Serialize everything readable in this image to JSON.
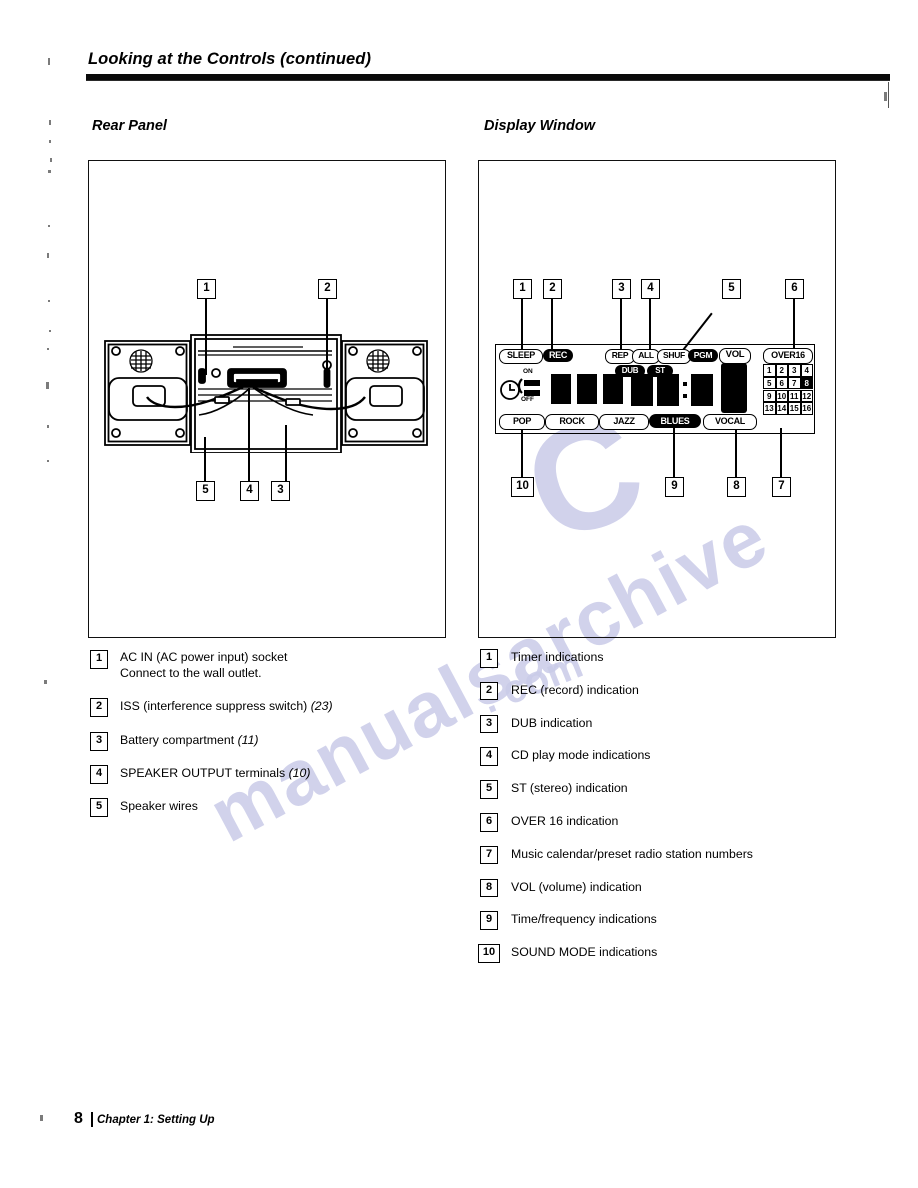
{
  "header": {
    "title": "Looking at the Controls (continued)"
  },
  "sections": {
    "rear": {
      "heading": "Rear Panel"
    },
    "display": {
      "heading": "Display Window"
    }
  },
  "rear_callouts": [
    {
      "num": "1"
    },
    {
      "num": "2"
    },
    {
      "num": "3"
    },
    {
      "num": "4"
    },
    {
      "num": "5"
    }
  ],
  "display_callouts": [
    {
      "num": "1"
    },
    {
      "num": "2"
    },
    {
      "num": "3"
    },
    {
      "num": "4"
    },
    {
      "num": "5"
    },
    {
      "num": "6"
    },
    {
      "num": "7"
    },
    {
      "num": "8"
    },
    {
      "num": "9"
    },
    {
      "num": "10"
    }
  ],
  "rear_legend": [
    {
      "num": "1",
      "line1": "AC IN (AC power input) socket",
      "line2": "Connect to the wall outlet.",
      "page": ""
    },
    {
      "num": "2",
      "line1": "ISS (interference suppress switch)",
      "line2": "",
      "page": "(23)"
    },
    {
      "num": "3",
      "line1": "Battery compartment",
      "line2": "",
      "page": "(11)"
    },
    {
      "num": "4",
      "line1": "SPEAKER OUTPUT terminals",
      "line2": "",
      "page": "(10)"
    },
    {
      "num": "5",
      "line1": "Speaker wires",
      "line2": "",
      "page": ""
    }
  ],
  "display_legend": [
    {
      "num": "1",
      "text": "Timer indications"
    },
    {
      "num": "2",
      "text": "REC (record) indication"
    },
    {
      "num": "3",
      "text": "DUB indication"
    },
    {
      "num": "4",
      "text": "CD play mode indications"
    },
    {
      "num": "5",
      "text": "ST (stereo) indication"
    },
    {
      "num": "6",
      "text": "OVER 16 indication"
    },
    {
      "num": "7",
      "text": "Music calendar/preset radio station numbers"
    },
    {
      "num": "8",
      "text": "VOL (volume) indication"
    },
    {
      "num": "9",
      "text": "Time/frequency indications"
    },
    {
      "num": "10",
      "text": "SOUND MODE indications"
    }
  ],
  "lcd": {
    "sleep": "SLEEP",
    "rec": "REC",
    "play_modes": [
      "REP",
      "ALL",
      "SHUF",
      "PGM"
    ],
    "dub_left": "DUB",
    "dub_right": "ST",
    "vol": "VOL",
    "over16": "OVER16",
    "timer_on": "ON",
    "timer_off": "OFF",
    "sound_modes": [
      "POP",
      "ROCK",
      "JAZZ",
      "BLUES",
      "VOCAL"
    ],
    "calendar": [
      "1",
      "2",
      "3",
      "4",
      "5",
      "6",
      "7",
      "8",
      "9",
      "10",
      "11",
      "12",
      "13",
      "14",
      "15",
      "16"
    ],
    "calendar_lit": [
      "8"
    ]
  },
  "footer": {
    "page_number": "8",
    "chapter": "Chapter 1: Setting Up"
  },
  "watermark": {
    "line1": "manualsarchive",
    "line2": "C",
    "line3": ". com"
  },
  "colors": {
    "ink": "#000000",
    "paper": "#ffffff",
    "watermark": "#c9cbe8"
  }
}
